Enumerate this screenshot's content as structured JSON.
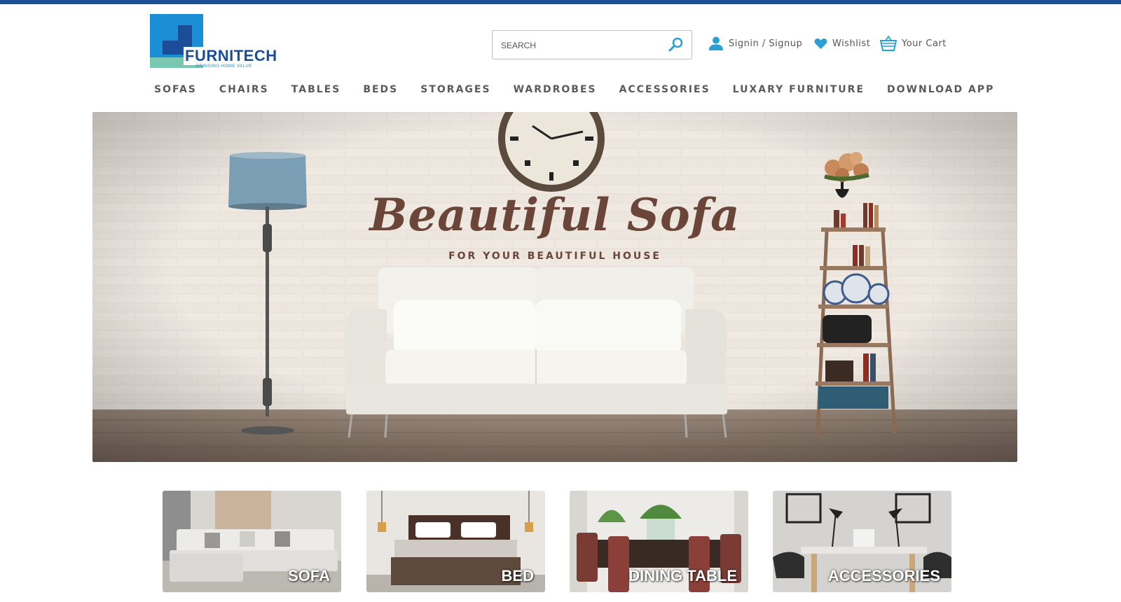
{
  "header": {
    "brand_name": "FURNITECH",
    "brand_tagline": "BRINGING HOME VALUE",
    "search_placeholder": "SEARCH",
    "signin_label": "Signin / Signup",
    "wishlist_label": "Wishlist",
    "cart_label": "Your Cart"
  },
  "nav": {
    "items": [
      "SOFAS",
      "CHAIRS",
      "TABLES",
      "BEDS",
      "STORAGES",
      "WARDROBES",
      "ACCESSORIES",
      "LUXARY FURNITURE",
      "DOWNLOAD APP"
    ]
  },
  "hero": {
    "title": "Beautiful Sofa",
    "subtitle": "FOR YOUR BEAUTIFUL HOUSE"
  },
  "categories": [
    {
      "label": "SOFA"
    },
    {
      "label": "BED"
    },
    {
      "label": "DINING TABLE"
    },
    {
      "label": "ACCESSORIES"
    }
  ],
  "colors": {
    "top_bar": "#1f4f96",
    "brand_dark_blue": "#1c4d99",
    "brand_light_blue": "#1a8fd6",
    "brand_teal": "#79c7b1",
    "icon_accent": "#2a9fd6",
    "hero_text": "#6b4638"
  }
}
